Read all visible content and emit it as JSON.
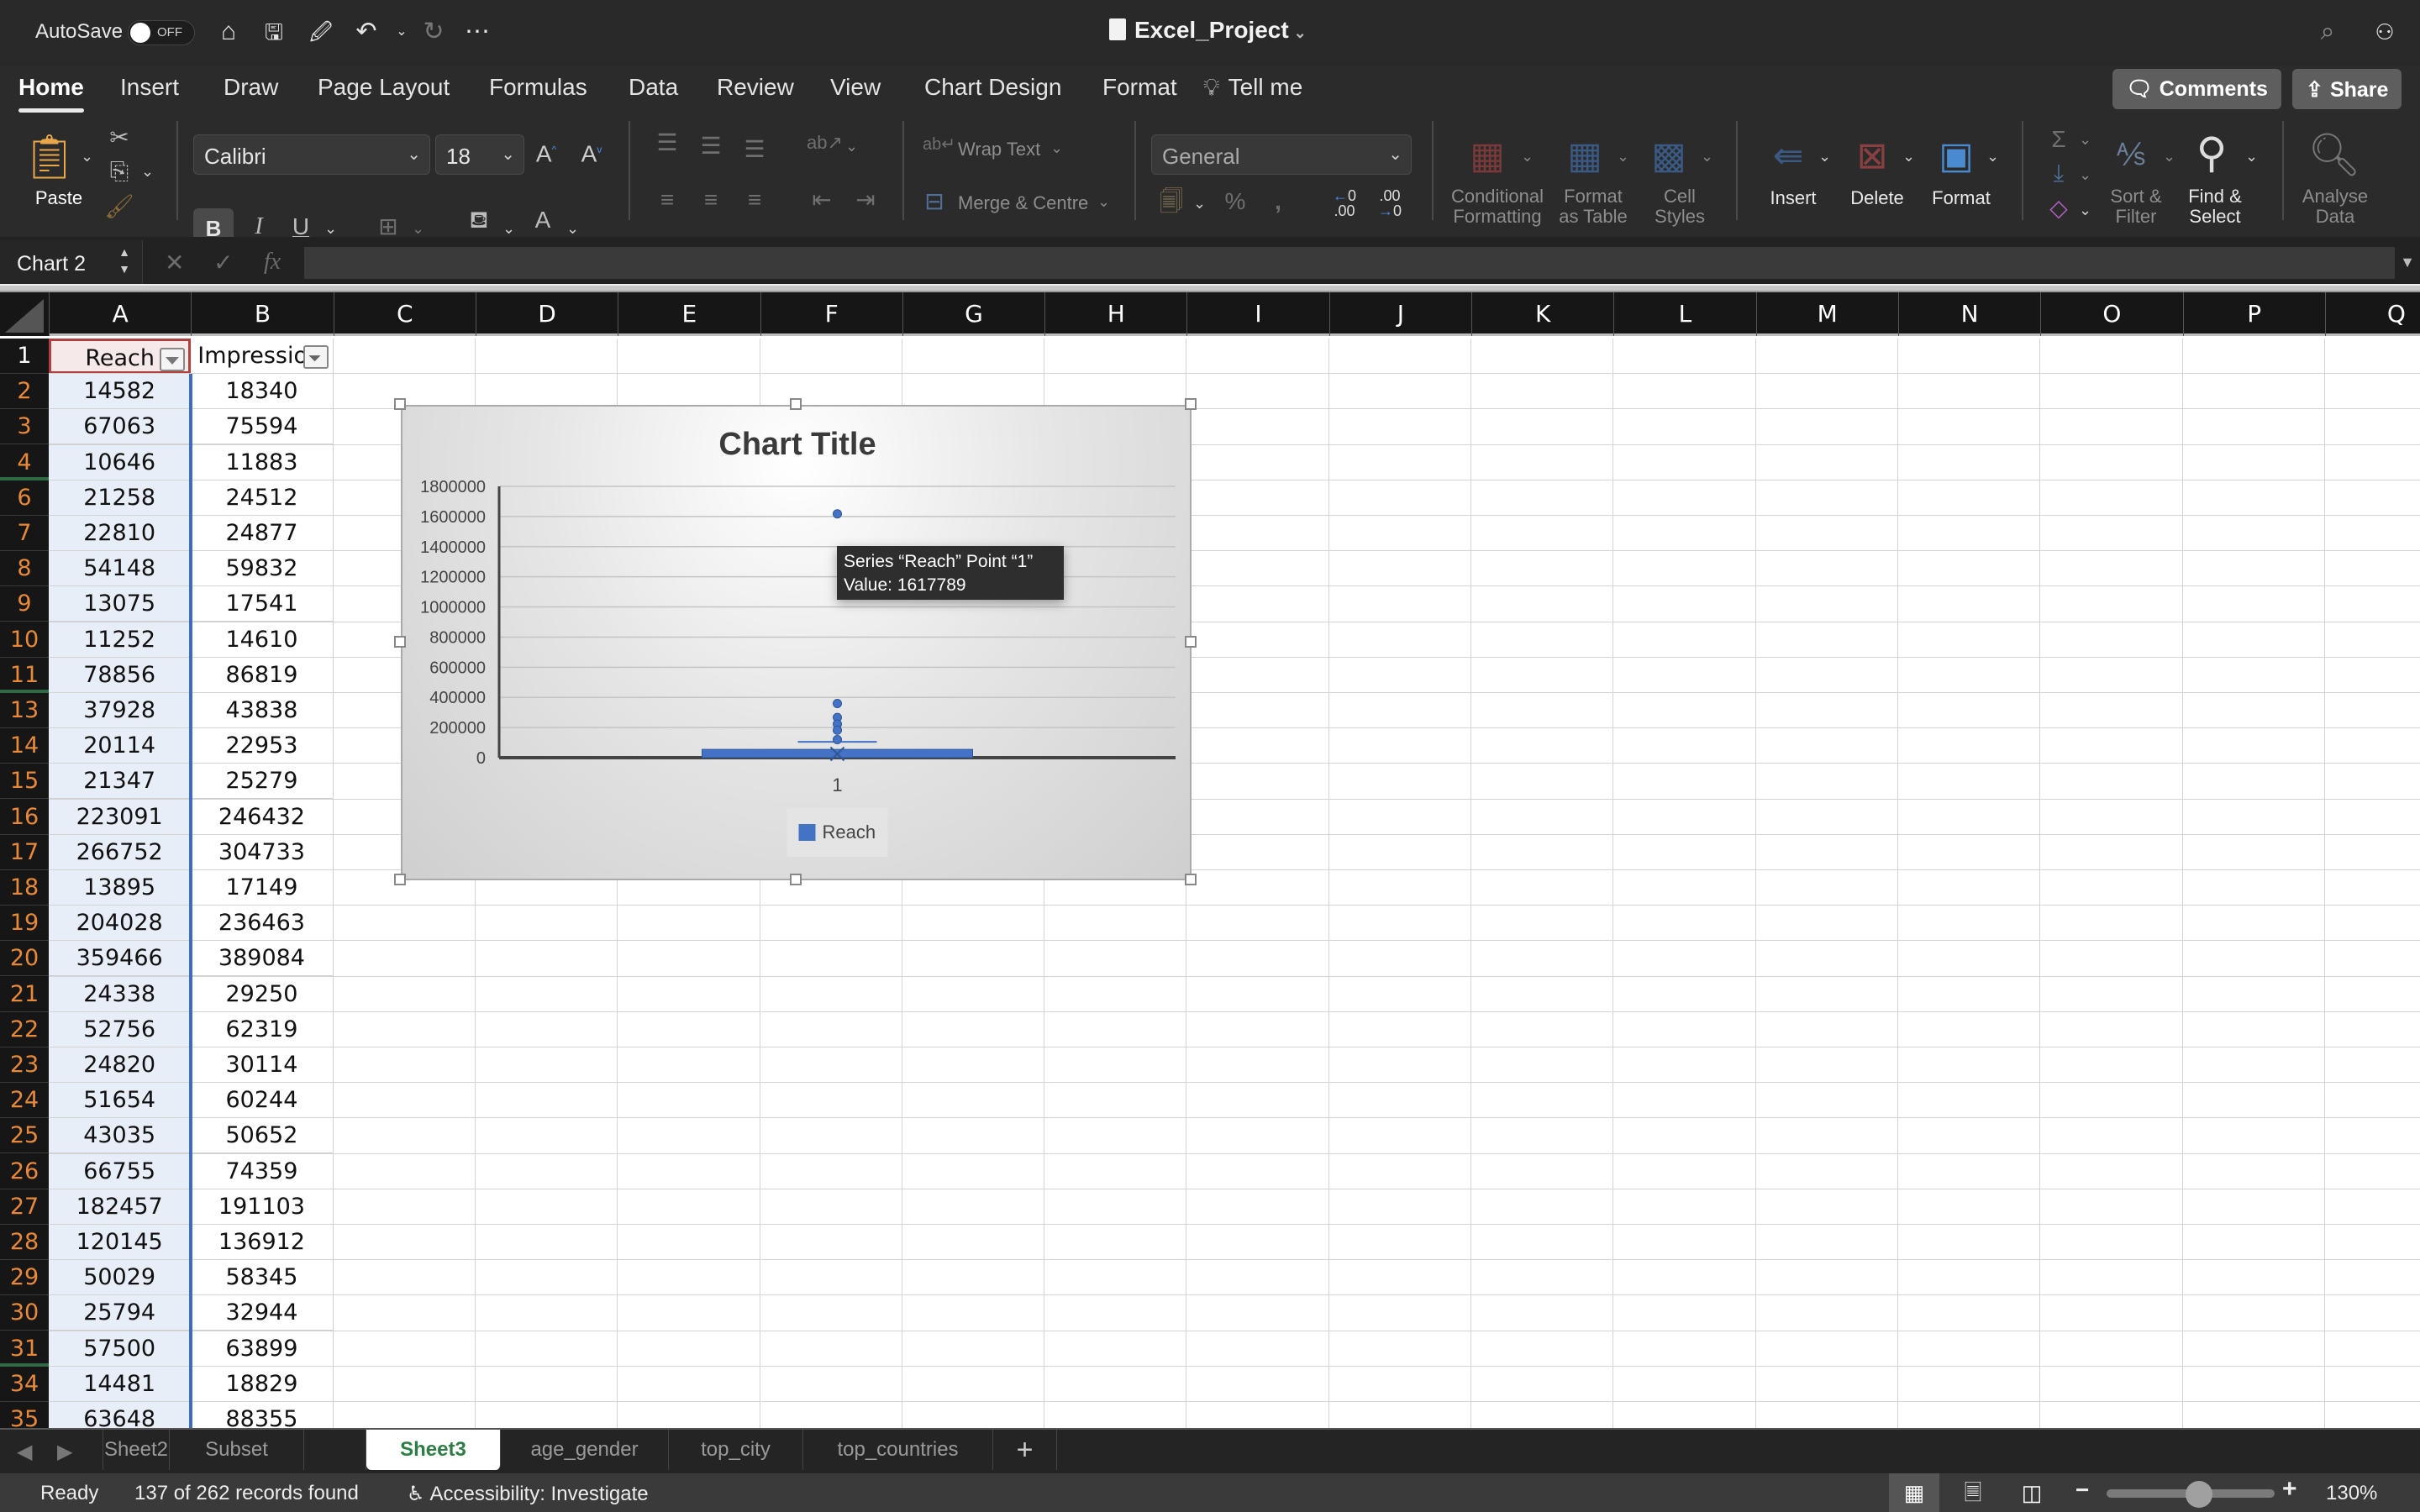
{
  "titlebar": {
    "autosave_label": "AutoSave",
    "autosave_state": "OFF",
    "doc_title": "Excel_Project",
    "icons": [
      "home-icon",
      "save-icon",
      "save-as-icon",
      "undo-icon",
      "redo-icon",
      "more-icon",
      "search-icon",
      "share-people-icon"
    ]
  },
  "ribbon_tabs": [
    "Home",
    "Insert",
    "Draw",
    "Page Layout",
    "Formulas",
    "Data",
    "Review",
    "View",
    "Chart Design",
    "Format"
  ],
  "active_tab": "Home",
  "tell_me": "Tell me",
  "comments_label": "Comments",
  "share_label": "Share",
  "ribbon": {
    "paste_label": "Paste",
    "font_name": "Calibri",
    "font_size": "18",
    "bold": "B",
    "italic": "I",
    "underline": "U",
    "wrap_text": "Wrap Text",
    "merge_centre": "Merge & Centre",
    "number_format": "General",
    "conditional_formatting": [
      "Conditional",
      "Formatting"
    ],
    "format_as_table": [
      "Format",
      "as Table"
    ],
    "cell_styles": [
      "Cell",
      "Styles"
    ],
    "insert": "Insert",
    "delete": "Delete",
    "format": "Format",
    "sort_filter": [
      "Sort &",
      "Filter"
    ],
    "find_select": [
      "Find &",
      "Select"
    ],
    "analyse_data": [
      "Analyse",
      "Data"
    ],
    "fill_color": "#e0823c",
    "font_color": "#e0342a"
  },
  "formula_bar": {
    "name_box": "Chart 2",
    "formula": "",
    "fx": "fx"
  },
  "columns": [
    "A",
    "B",
    "C",
    "D",
    "E",
    "F",
    "G",
    "H",
    "I",
    "J",
    "K",
    "L",
    "M",
    "N",
    "O",
    "P",
    "Q"
  ],
  "table": {
    "headers": [
      "Reach",
      "Impression"
    ],
    "rows": [
      {
        "row": "2",
        "reach": "14582",
        "impressions": "18340"
      },
      {
        "row": "3",
        "reach": "67063",
        "impressions": "75594"
      },
      {
        "row": "4",
        "reach": "10646",
        "impressions": "11883"
      },
      {
        "row": "6",
        "reach": "21258",
        "impressions": "24512"
      },
      {
        "row": "7",
        "reach": "22810",
        "impressions": "24877"
      },
      {
        "row": "8",
        "reach": "54148",
        "impressions": "59832"
      },
      {
        "row": "9",
        "reach": "13075",
        "impressions": "17541"
      },
      {
        "row": "10",
        "reach": "11252",
        "impressions": "14610"
      },
      {
        "row": "11",
        "reach": "78856",
        "impressions": "86819"
      },
      {
        "row": "13",
        "reach": "37928",
        "impressions": "43838"
      },
      {
        "row": "14",
        "reach": "20114",
        "impressions": "22953"
      },
      {
        "row": "15",
        "reach": "21347",
        "impressions": "25279"
      },
      {
        "row": "16",
        "reach": "223091",
        "impressions": "246432"
      },
      {
        "row": "17",
        "reach": "266752",
        "impressions": "304733"
      },
      {
        "row": "18",
        "reach": "13895",
        "impressions": "17149"
      },
      {
        "row": "19",
        "reach": "204028",
        "impressions": "236463"
      },
      {
        "row": "20",
        "reach": "359466",
        "impressions": "389084"
      },
      {
        "row": "21",
        "reach": "24338",
        "impressions": "29250"
      },
      {
        "row": "22",
        "reach": "52756",
        "impressions": "62319"
      },
      {
        "row": "23",
        "reach": "24820",
        "impressions": "30114"
      },
      {
        "row": "24",
        "reach": "51654",
        "impressions": "60244"
      },
      {
        "row": "25",
        "reach": "43035",
        "impressions": "50652"
      },
      {
        "row": "26",
        "reach": "66755",
        "impressions": "74359"
      },
      {
        "row": "27",
        "reach": "182457",
        "impressions": "191103"
      },
      {
        "row": "28",
        "reach": "120145",
        "impressions": "136912"
      },
      {
        "row": "29",
        "reach": "50029",
        "impressions": "58345"
      },
      {
        "row": "30",
        "reach": "25794",
        "impressions": "32944"
      },
      {
        "row": "31",
        "reach": "57500",
        "impressions": "63899"
      },
      {
        "row": "34",
        "reach": "14481",
        "impressions": "18829"
      },
      {
        "row": "35",
        "reach": "63648",
        "impressions": "88355"
      }
    ]
  },
  "chart_data": {
    "type": "box",
    "title": "Chart Title",
    "categories": [
      "1"
    ],
    "series": [
      {
        "name": "Reach",
        "color": "#4472c4",
        "box": {
          "q1": 0,
          "q3": 55000,
          "median": 25000,
          "mean": 105000
        },
        "outliers": [
          1617789,
          359466,
          266752,
          223091,
          182457,
          120145
        ]
      }
    ],
    "yticks": [
      "0",
      "200000",
      "400000",
      "600000",
      "800000",
      "1000000",
      "1200000",
      "1400000",
      "1600000",
      "1800000"
    ],
    "ylim": [
      0,
      1800000
    ],
    "grid": true,
    "legend": "bottom",
    "tooltip": {
      "line1": "Series “Reach” Point “1”",
      "line2": "Value: 1617789"
    }
  },
  "sheet_tabs": [
    "Sheet2",
    "Subset",
    "Sheet3",
    "age_gender",
    "top_city",
    "top_countries"
  ],
  "active_sheet": "Sheet3",
  "status": {
    "ready": "Ready",
    "records": "137 of 262 records found",
    "accessibility": "Accessibility: Investigate",
    "zoom": "130%",
    "zoom_fraction": 0.55
  }
}
